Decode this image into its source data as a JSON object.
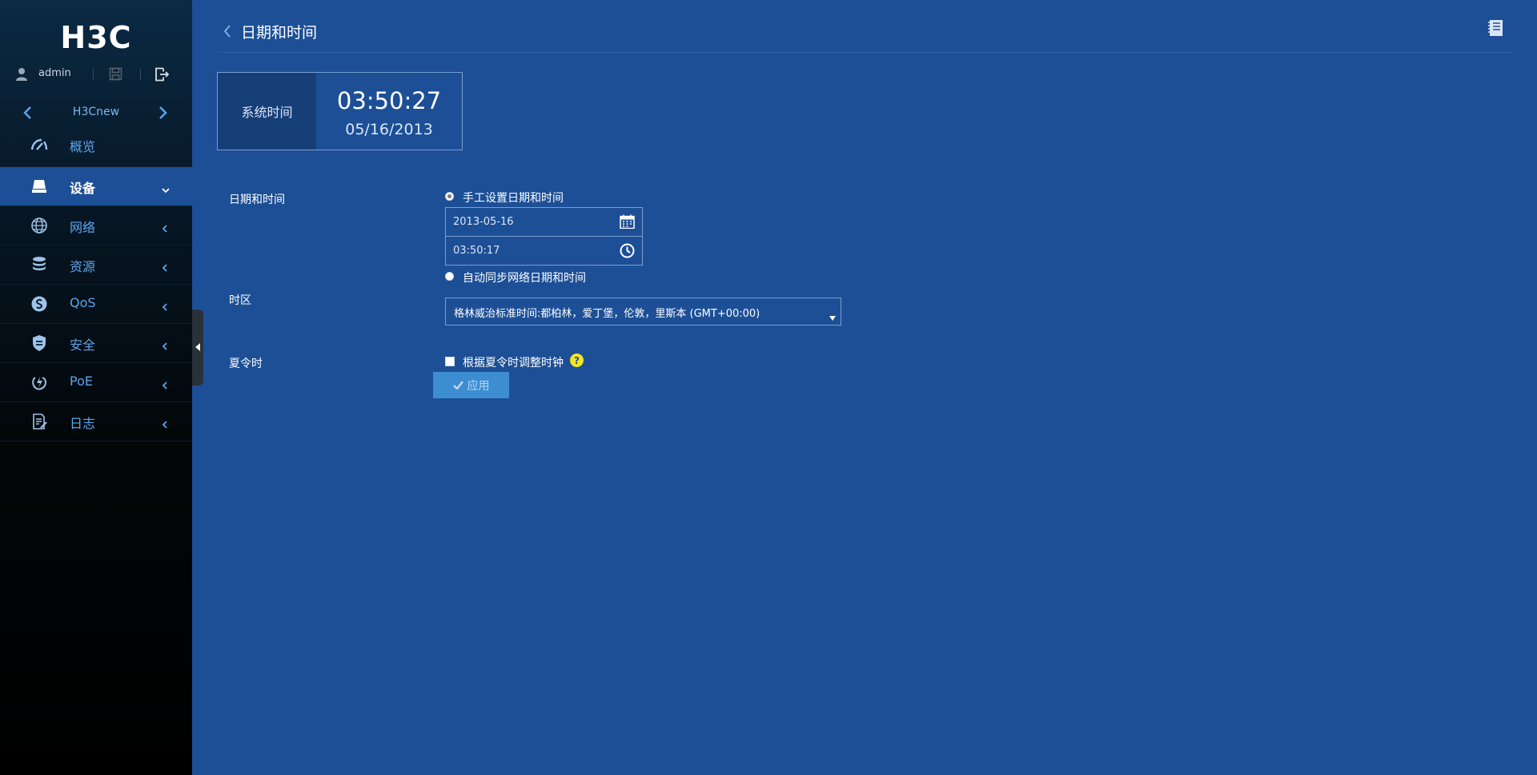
{
  "app": {
    "logo_text": "H3C",
    "user": "admin",
    "device_name": "H3Cnew"
  },
  "sidebar": {
    "items": [
      {
        "label": "概览",
        "icon": "dashboard-gauge-icon"
      },
      {
        "label": "设备",
        "icon": "device-icon",
        "active": true
      },
      {
        "label": "网络",
        "icon": "globe-icon"
      },
      {
        "label": "资源",
        "icon": "database-icon"
      },
      {
        "label": "QoS",
        "icon": "qos-icon"
      },
      {
        "label": "安全",
        "icon": "shield-icon"
      },
      {
        "label": "PoE",
        "icon": "power-icon"
      },
      {
        "label": "日志",
        "icon": "log-icon"
      }
    ]
  },
  "page": {
    "title": "日期和时间"
  },
  "clock": {
    "label": "系统时间",
    "time": "03:50:27",
    "date": "05/16/2013"
  },
  "form": {
    "datetime_label": "日期和时间",
    "manual_option": "手工设置日期和时间",
    "date_value": "2013-05-16",
    "time_value": "03:50:17",
    "auto_option": "自动同步网络日期和时间",
    "timezone_label": "时区",
    "timezone_value": "格林威治标准时间:都柏林，爱丁堡，伦敦，里斯本 (GMT+00:00)",
    "dst_label": "夏令时",
    "dst_option": "根据夏令时调整时钟",
    "help_glyph": "?",
    "apply_label": "应用"
  },
  "colors": {
    "background": "#1d4f96",
    "nav_label": "#5ca6ef",
    "apply_button": "#3d8dd2",
    "help_dot": "#f5e625"
  }
}
